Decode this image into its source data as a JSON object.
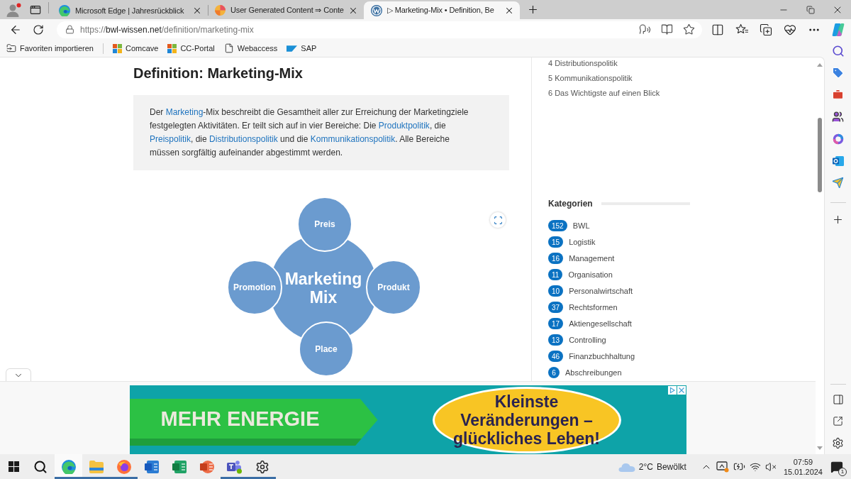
{
  "browser": {
    "tabs": [
      {
        "title": "Microsoft Edge | Jahresrückblick",
        "kind": "edge",
        "selected": false
      },
      {
        "title": "User Generated Content ⇒ Conte",
        "kind": "colorful",
        "selected": false
      },
      {
        "title": "▷ Marketing-Mix • Definition, Be",
        "kind": "wordpress",
        "selected": true
      }
    ],
    "url": {
      "scheme": "https://",
      "host": "bwl-wissen.net",
      "path": "/definition/marketing-mix"
    },
    "favorites": [
      {
        "label": "Favoriten importieren",
        "kind": "import"
      },
      {
        "label": "Comcave",
        "kind": "tiles"
      },
      {
        "label": "CC-Portal",
        "kind": "tiles"
      },
      {
        "label": "Webaccess",
        "kind": "page"
      },
      {
        "label": "SAP",
        "kind": "sap"
      }
    ]
  },
  "article": {
    "heading": "Definition: Marketing-Mix",
    "summary": [
      {
        "text": "Der ",
        "link": false
      },
      {
        "text": "Marketing",
        "link": true
      },
      {
        "text": "-Mix beschreibt die Gesamtheit aller zur Erreichung der Marketingziele festgelegten Aktivitäten. Er teilt sich auf in vier Bereiche: Die ",
        "link": false
      },
      {
        "text": "Produktpolitik",
        "link": true
      },
      {
        "text": ", die ",
        "link": false
      },
      {
        "text": "Preispolitik",
        "link": true
      },
      {
        "text": ", die ",
        "link": false
      },
      {
        "text": "Distributionspolitik",
        "link": true
      },
      {
        "text": " und die ",
        "link": false
      },
      {
        "text": "Kommunikationspolitik",
        "link": true
      },
      {
        "text": ". Alle Bereiche müssen sorgfältig aufeinander abgestimmt werden.",
        "link": false
      }
    ],
    "diagram": {
      "center": "Marketing Mix",
      "nodes": [
        "Preis",
        "Promotion",
        "Produkt",
        "Place"
      ]
    }
  },
  "sidebar": {
    "toc": [
      "4 Distributionspolitik",
      "5 Kommunikationspolitik",
      "6 Das Wichtigste auf einen Blick"
    ],
    "categories": {
      "title": "Kategorien",
      "items": [
        {
          "count": "152",
          "name": "BWL"
        },
        {
          "count": "15",
          "name": "Logistik"
        },
        {
          "count": "16",
          "name": "Management"
        },
        {
          "count": "11",
          "name": "Organisation"
        },
        {
          "count": "10",
          "name": "Personalwirtschaft"
        },
        {
          "count": "37",
          "name": "Rechtsformen"
        },
        {
          "count": "17",
          "name": "Aktiengesellschaft"
        },
        {
          "count": "13",
          "name": "Controlling"
        },
        {
          "count": "46",
          "name": "Finanzbuchhaltung"
        },
        {
          "count": "6",
          "name": "Abschreibungen"
        }
      ]
    }
  },
  "ad": {
    "headline": "MEHR ENERGIE",
    "slogan_lines": [
      "Kleinste",
      "Veränderungen –",
      "glückliches Leben!"
    ]
  },
  "taskbar": {
    "apps": [
      {
        "kind": "edge",
        "running": true,
        "selected": true
      },
      {
        "kind": "explorer",
        "running": true,
        "selected": false
      },
      {
        "kind": "firefox",
        "running": true,
        "selected": false
      },
      {
        "kind": "word",
        "running": false,
        "selected": false
      },
      {
        "kind": "excel",
        "running": false,
        "selected": false
      },
      {
        "kind": "powerpoint",
        "running": false,
        "selected": false
      },
      {
        "kind": "teams",
        "running": true,
        "selected": false
      },
      {
        "kind": "settings",
        "running": true,
        "selected": false
      }
    ],
    "weather": {
      "temperature": "2°C",
      "condition": "Bewölkt"
    },
    "clock": {
      "time": "07:59",
      "date": "15.01.2024"
    },
    "notifications": "1"
  }
}
